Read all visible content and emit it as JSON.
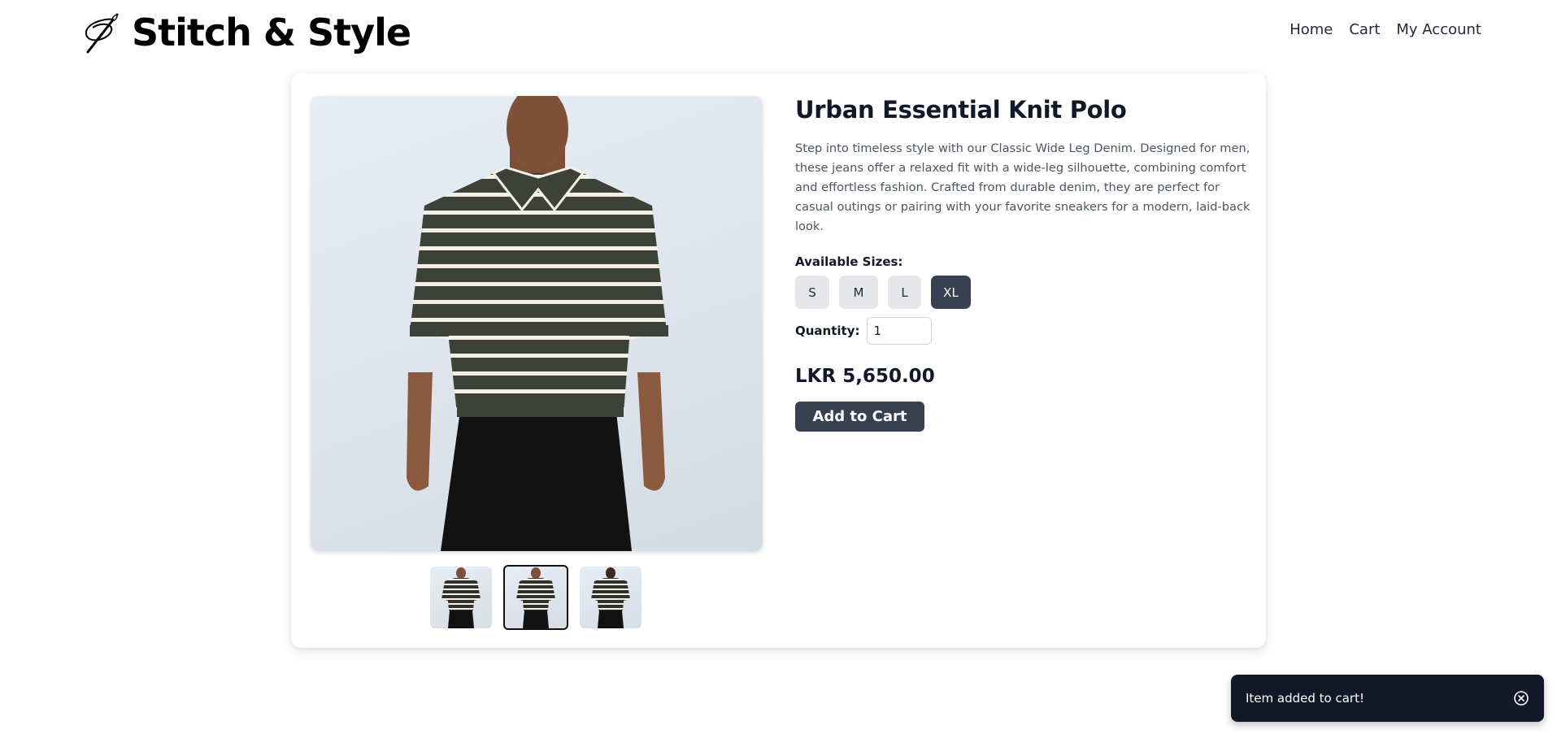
{
  "brand": {
    "name": "Stitch & Style",
    "icon": "needle-thread-icon"
  },
  "nav": {
    "home": "Home",
    "cart": "Cart",
    "account": "My Account"
  },
  "product": {
    "title": "Urban Essential Knit Polo",
    "description": "Step into timeless style with our Classic Wide Leg Denim. Designed for men, these jeans offer a relaxed fit with a wide-leg silhouette, combining comfort and effortless fashion. Crafted from durable denim, they are perfect for casual outings or pairing with your favorite sneakers for a modern, laid-back look.",
    "sizes_label": "Available Sizes:",
    "sizes": [
      "S",
      "M",
      "L",
      "XL"
    ],
    "selected_size": "XL",
    "quantity_label": "Quantity:",
    "quantity": "1",
    "price": "LKR 5,650.00",
    "add_to_cart": "Add to Cart",
    "selected_thumbnail": 2
  },
  "toast": {
    "message": "Item added to cart!",
    "icon": "close-circle-icon"
  },
  "colors": {
    "accent": "#374151",
    "toast_bg": "#111827",
    "size_inactive": "#e5e7eb",
    "shirt": "#3c4237",
    "stripe": "#f3efe4"
  }
}
